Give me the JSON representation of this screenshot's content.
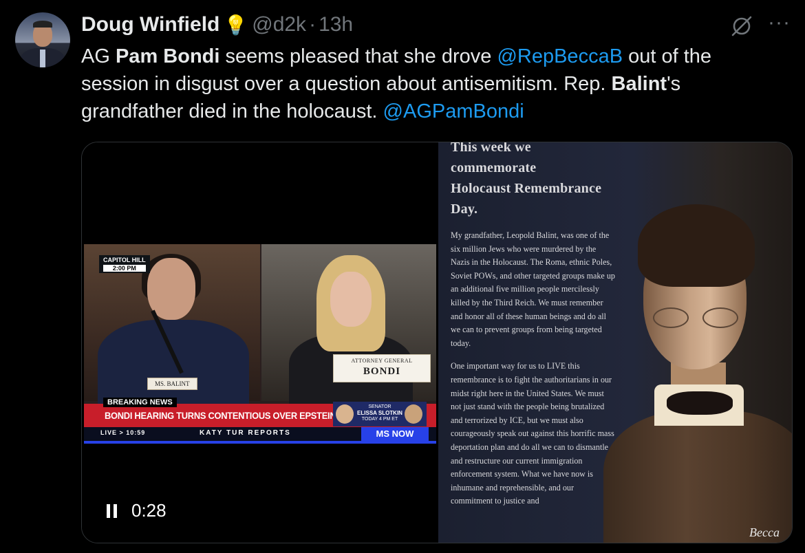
{
  "author": {
    "name": "Doug Winfield",
    "badge_icon": "lightbulb-icon",
    "handle": "@d2k",
    "separator": "·",
    "time": "13h"
  },
  "actions": {
    "grok_icon": "grok-icon",
    "more_label": "···"
  },
  "tweet": {
    "t1": "AG ",
    "b1": "Pam Bondi",
    "t2": " seems pleased that she drove  ",
    "m1": "@RepBeccaB",
    "t3": " out of the session in disgust over a question about antisemitism. Rep. ",
    "b2": "Balint",
    "t4": "'s grandfather died in the holocaust. ",
    "m2": "@AGPamBondi"
  },
  "video": {
    "capitol_tag": "CAPITOL HILL",
    "capitol_time": "2:00 PM",
    "nameplate_left": "MS. BALINT",
    "nameplate_right_title": "ATTORNEY GENERAL",
    "nameplate_right_name": "BONDI",
    "breaking": "BREAKING NEWS",
    "headline": "BONDI HEARING TURNS CONTENTIOUS OVER EPSTEIN FILES",
    "promo_line1": "SENATOR",
    "promo_name": "ELISSA SLOTKIN",
    "promo_time": "TODAY 4 PM ET",
    "live": "LIVE > 10:59",
    "show": "KATY TUR REPORTS",
    "network": "MS NOW",
    "elapsed": "0:28",
    "pause_icon": "pause-icon"
  },
  "image": {
    "heading1": "This week we commemorate",
    "heading2": "Holocaust Remembrance Day.",
    "p1": "My grandfather, Leopold Balint, was one of the six million Jews who were murdered by the Nazis in the Holocaust. The Roma, ethnic Poles, Soviet POWs, and other targeted groups make up an additional five million people mercilessly killed by the Third Reich. We must remember and honor all of these human beings and do all we can to prevent groups from being targeted today.",
    "p2": "One important way for us to LIVE this remembrance is to fight the authoritarians in our midst right here in the United States. We must not just stand with the people being brutalized and terrorized by ICE, but we must also courageously speak out against this horrific mass deportation plan and do all we can to dismantle and restructure our current immigration enforcement system. What we have now is inhumane and reprehensible, and our commitment to justice and",
    "signature": "Becca"
  },
  "colors": {
    "link": "#1d9bf0",
    "background": "#000000",
    "muted": "#71767b",
    "headline_red": "#c81e2a",
    "network_blue": "#2741e8"
  }
}
